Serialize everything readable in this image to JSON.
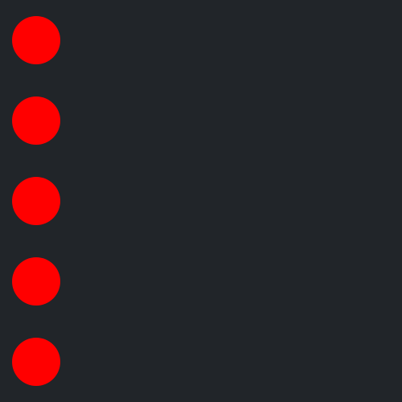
{
  "theme": {
    "background": "#212529",
    "dot_color": "#ff0000"
  },
  "dots": [
    {
      "shape": "circle"
    },
    {
      "shape": "circle"
    },
    {
      "shape": "circle"
    },
    {
      "shape": "circle"
    },
    {
      "shape": "circle"
    }
  ]
}
